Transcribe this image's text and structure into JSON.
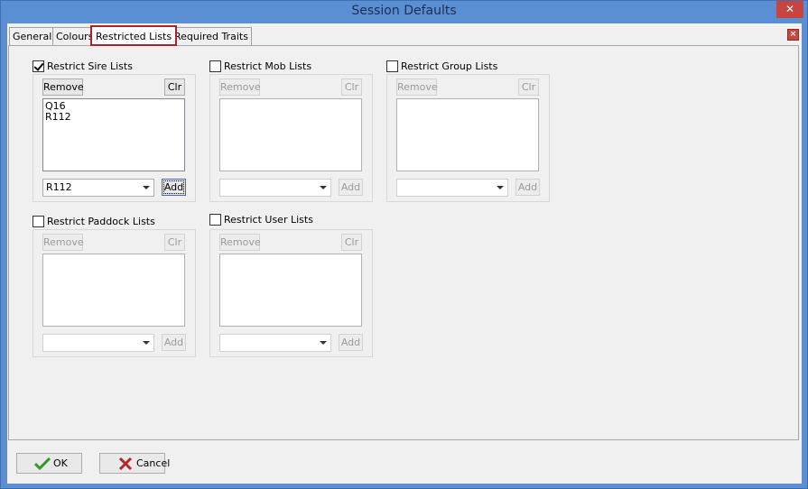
{
  "window": {
    "title": "Session Defaults",
    "close_glyph": "✕"
  },
  "tabs": [
    {
      "label": "General"
    },
    {
      "label": "Colours"
    },
    {
      "label": "Restricted Lists"
    },
    {
      "label": "Required Traits"
    }
  ],
  "tab_close_glyph": "×",
  "groups": {
    "sire": {
      "label": "Restrict Sire Lists",
      "checked": true,
      "remove_label": "Remove",
      "clr_label": "Clr",
      "add_label": "Add",
      "items": [
        "Q16",
        "R112"
      ],
      "combo_value": "R112"
    },
    "mob": {
      "label": "Restrict Mob Lists",
      "checked": false,
      "remove_label": "Remove",
      "clr_label": "Clr",
      "add_label": "Add",
      "combo_value": ""
    },
    "group": {
      "label": "Restrict Group Lists",
      "checked": false,
      "remove_label": "Remove",
      "clr_label": "Clr",
      "add_label": "Add",
      "combo_value": ""
    },
    "paddock": {
      "label": "Restrict Paddock Lists",
      "checked": false,
      "remove_label": "Remove",
      "clr_label": "Clr",
      "add_label": "Add",
      "combo_value": ""
    },
    "user": {
      "label": "Restrict User Lists",
      "checked": false,
      "remove_label": "Remove",
      "clr_label": "Clr",
      "add_label": "Add",
      "combo_value": ""
    }
  },
  "footer": {
    "ok_label": "OK",
    "cancel_label": "Cancel"
  },
  "colors": {
    "title_bg": "#5b8fd4",
    "active_tab_border": "#b0202a",
    "ok_icon": "#2f9a2a",
    "cancel_icon": "#b3262a"
  }
}
